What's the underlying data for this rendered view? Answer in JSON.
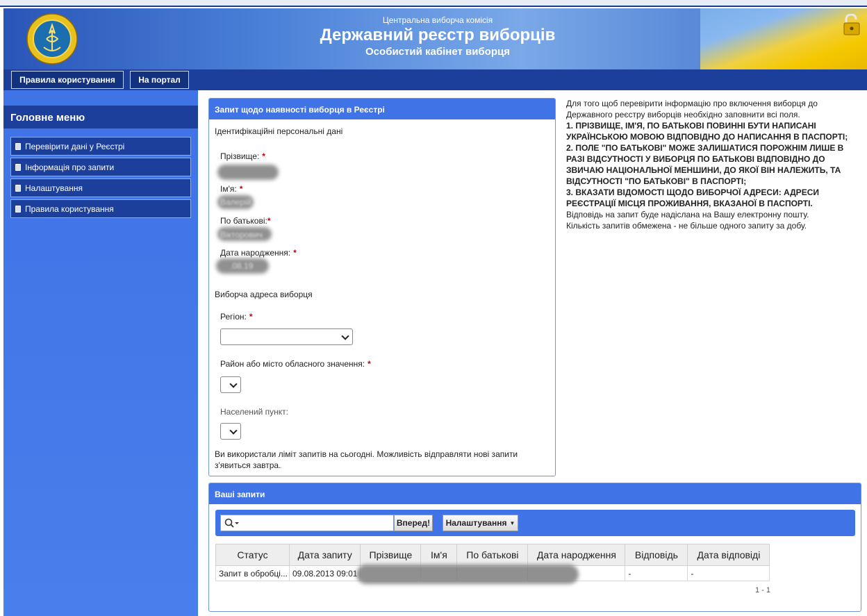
{
  "header": {
    "commission": "Центральна виборча комісія",
    "title": "Державний реєстр виборців",
    "subtitle": "Особистий кабінет виборця"
  },
  "nav": {
    "rules": "Правила користування",
    "portal": "На портал"
  },
  "sidebar": {
    "title": "Головне меню",
    "items": [
      {
        "label": "Перевірити дані у Реєстрі"
      },
      {
        "label": "Інформація про запити"
      },
      {
        "label": "Налаштування"
      },
      {
        "label": "Правила користування"
      }
    ]
  },
  "form": {
    "panel_title": "Запит щодо наявності виборця в Реєстрі",
    "section_personal": "Ідентифікаційні персональні дані",
    "surname_label": "Прізвище:",
    "name_label": "Ім'я:",
    "name_value": "Валерій",
    "patronymic_label": "По батькові:",
    "patronymic_value": "Вікторович",
    "birthdate_label": "Дата народження:",
    "birthdate_value": ".08.19",
    "section_address": "Виборча адреса виборця",
    "region_label": "Регіон:",
    "district_label": "Район або місто обласного значення:",
    "locality_label": "Населений пункт:",
    "limit_message": "Ви використали ліміт запитів на сьогодні. Можливість відправляти нові запити з'явиться завтра.",
    "required_mark": "*"
  },
  "info": {
    "intro": "Для того щоб перевірити інформацію про включення виборця до Державного реєстру виборців необхідно заповнити всі поля.",
    "rule1": "1. ПРІЗВИЩЕ, ІМ'Я, ПО БАТЬКОВІ ПОВИННІ БУТИ НАПИСАНІ УКРАЇНСЬКОЮ МОВОЮ ВІДПОВІДНО ДО НАПИСАННЯ В ПАСПОРТІ;",
    "rule2": "2. ПОЛЕ \"ПО БАТЬКОВІ\" МОЖЕ ЗАЛИШАТИСЯ ПОРОЖНІМ ЛИШЕ В РАЗІ ВІДСУТНОСТІ У ВИБОРЦЯ ПО БАТЬКОВІ ВІДПОВІДНО ДО ЗВИЧАЮ НАЦІОНАЛЬНОЇ МЕНШИНИ, ДО ЯКОЇ ВІН НАЛЕЖИТЬ, ТА ВІДСУТНОСТІ \"ПО БАТЬКОВІ\" В ПАСПОРТІ;",
    "rule3": "3. ВКАЗАТИ ВІДОМОСТІ ЩОДО ВИБОРЧОЇ АДРЕСИ: АДРЕСИ РЕЄСТРАЦІЇ МІСЦЯ ПРОЖИВАННЯ, ВКАЗАНОЇ В ПАСПОРТІ.",
    "email_note": "Відповідь на запит буде надіслана на Вашу електронну пошту.",
    "limit_note": "Кількість запитів обмежена - не більше одного запиту за добу."
  },
  "requests": {
    "panel_title": "Ваші запити",
    "forward_button": "Вперед!",
    "settings_button": "Налаштування",
    "columns": [
      "Статус",
      "Дата запиту",
      "Прізвище",
      "Ім'я",
      "По батькові",
      "Дата народження",
      "Відповідь",
      "Дата відповіді"
    ],
    "rows": [
      {
        "status": "Запит в обробці...",
        "date": "09.08.2013 09:01",
        "answer": "-",
        "answer_date": "-"
      }
    ],
    "pager": "1 - 1"
  },
  "colors": {
    "nav_blue": "#1c3f9c",
    "accent_blue": "#3f73e6",
    "required_red": "#cc0000"
  },
  "icons": [
    "emblem-icon",
    "lock-icon",
    "search-icon",
    "dropdown-caret-icon"
  ]
}
